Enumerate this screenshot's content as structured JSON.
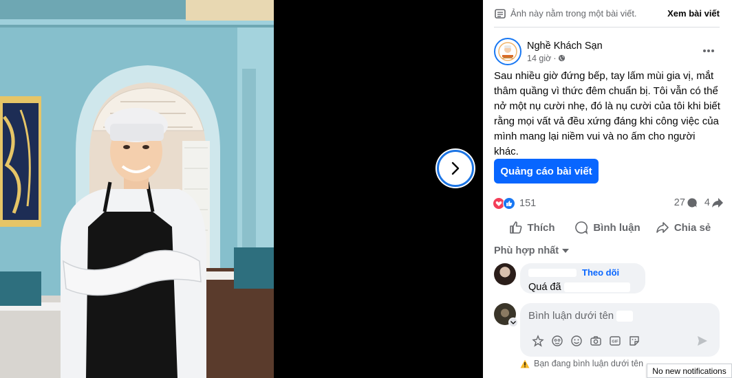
{
  "viewer": {
    "next_icon": "chevron-right-icon"
  },
  "panel": {
    "note_text": "Ảnh này nằm trong một bài viết.",
    "view_post": "Xem bài viết",
    "author": {
      "name": "Nghề Khách Sạn",
      "time": "14 giờ",
      "separator": "·",
      "audience_icon": "globe-icon"
    },
    "post_text": "Sau nhiều giờ đứng bếp, tay lấm mùi gia vị, mắt thâm quầng vì thức đêm chuẩn bị. Tôi vẫn có thể nở một nụ cười nhẹ, đó là nụ cười của tôi khi biết rằng mọi vất vả đều xứng đáng khi công việc của mình mang lại niềm vui và no ấm cho người khác.",
    "boost_label": "Quảng cáo bài viết",
    "reactions": {
      "count": "151",
      "comments": "27",
      "shares": "4"
    },
    "actions": {
      "like": "Thích",
      "comment": "Bình luận",
      "share": "Chia sẻ"
    },
    "sort_label": "Phù hợp nhất",
    "comment": {
      "follow": "Theo dõi",
      "text": "Quá đã"
    },
    "composer": {
      "placeholder": "Bình luận dưới tên"
    },
    "warning": "Bạn đang bình luận dưới tên"
  },
  "toast": "No new notifications",
  "colors": {
    "accent": "#0866ff",
    "love": "#f33e58",
    "like": "#1877f2"
  }
}
